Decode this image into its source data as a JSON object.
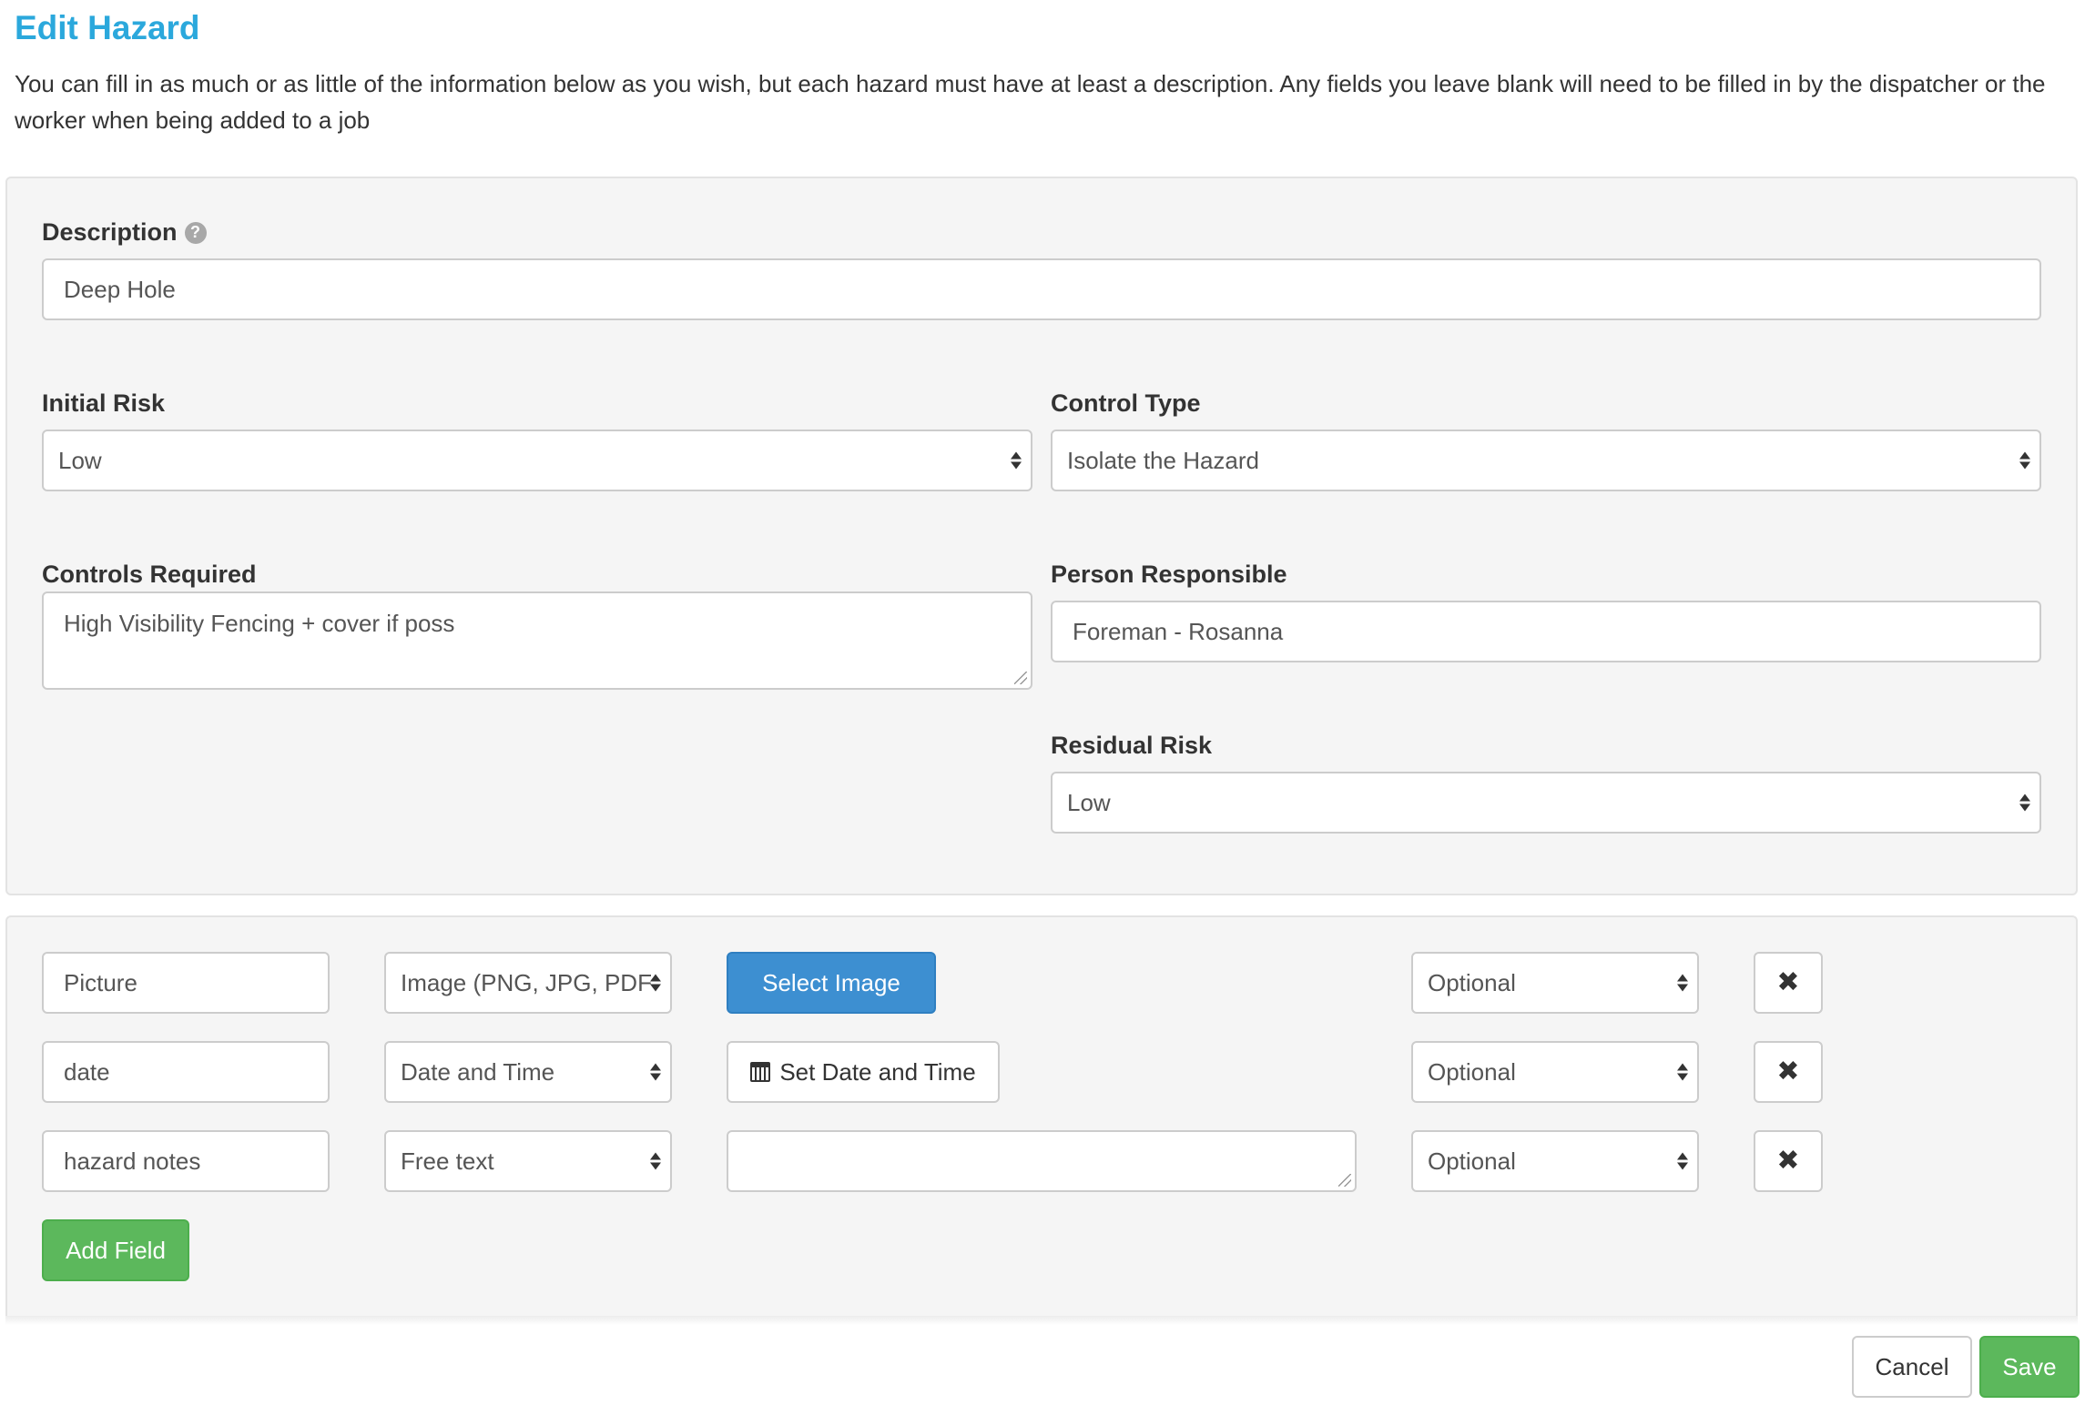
{
  "page": {
    "title": "Edit Hazard",
    "intro": "You can fill in as much or as little of the information below as you wish, but each hazard must have at least a description. Any fields you leave blank will need to be filled in by the dispatcher or the worker when being added to a job"
  },
  "form": {
    "description": {
      "label": "Description",
      "help_icon": "?",
      "value": "Deep Hole"
    },
    "initial_risk": {
      "label": "Initial Risk",
      "value": "Low"
    },
    "control_type": {
      "label": "Control Type",
      "value": "Isolate the Hazard"
    },
    "controls_required": {
      "label": "Controls Required",
      "value": "High Visibility Fencing + cover if poss"
    },
    "person_responsible": {
      "label": "Person Responsible",
      "value": "Foreman - Rosanna"
    },
    "residual_risk": {
      "label": "Residual Risk",
      "value": "Low"
    }
  },
  "custom_fields": [
    {
      "name": "Picture",
      "type": "Image (PNG, JPG, PDF",
      "action_label": "Select Image",
      "requirement": "Optional"
    },
    {
      "name": "date",
      "type": "Date and Time",
      "action_label": "Set Date and Time",
      "requirement": "Optional"
    },
    {
      "name": "hazard notes",
      "type": "Free text",
      "value": "",
      "requirement": "Optional"
    }
  ],
  "buttons": {
    "add_field": "Add Field",
    "cancel": "Cancel",
    "save": "Save",
    "remove_icon": "✖"
  },
  "icons": {
    "help": "help-icon",
    "calendar": "calendar-icon",
    "remove": "close-icon"
  },
  "colors": {
    "title": "#2ba8dc",
    "primary": "#3d8fd1",
    "success": "#5cb85c",
    "panel_bg": "#f5f5f5"
  }
}
